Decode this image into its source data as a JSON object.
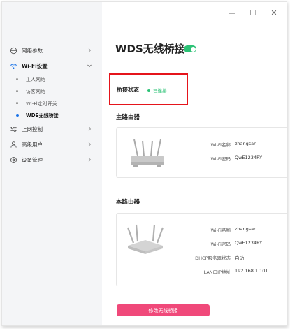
{
  "window": {
    "controls": [
      "—",
      "☐",
      "✕"
    ]
  },
  "sidebar": {
    "items": [
      {
        "label": "网络参数",
        "icon": "globe-icon",
        "expanded": false
      },
      {
        "label": "Wi-Fi设置",
        "icon": "wifi-icon",
        "expanded": true,
        "children": [
          {
            "label": "主人网络",
            "active": false
          },
          {
            "label": "访客网络",
            "active": false
          },
          {
            "label": "Wi-Fi定时开关",
            "active": false
          },
          {
            "label": "WDS无线桥接",
            "active": true
          }
        ]
      },
      {
        "label": "上网控制",
        "icon": "sliders-icon",
        "expanded": false
      },
      {
        "label": "高级用户",
        "icon": "user-icon",
        "expanded": false
      },
      {
        "label": "设备管理",
        "icon": "gear-icon",
        "expanded": false
      }
    ]
  },
  "main": {
    "title": "WDS无线桥接",
    "toggle_on": true,
    "status": {
      "label": "桥接状态",
      "value": "已连接",
      "color": "#2cc276"
    },
    "primary_router": {
      "heading": "主路由器",
      "fields": [
        {
          "key": "Wi-Fi名称",
          "value": "zhangsan"
        },
        {
          "key": "Wi-Fi密码",
          "value": "QwE1234RY"
        }
      ]
    },
    "local_router": {
      "heading": "本路由器",
      "fields": [
        {
          "key": "Wi-Fi名称",
          "value": "zhangsan"
        },
        {
          "key": "Wi-Fi密码",
          "value": "QwE1234RY"
        },
        {
          "key": "DHCP服务器状态",
          "value": "自动"
        },
        {
          "key": "LAN口IP地址",
          "value": "192.168.1.101"
        }
      ]
    },
    "button_label": "修改无线桥接",
    "accent": "#f0497a",
    "alert_border": "#e5141b"
  }
}
